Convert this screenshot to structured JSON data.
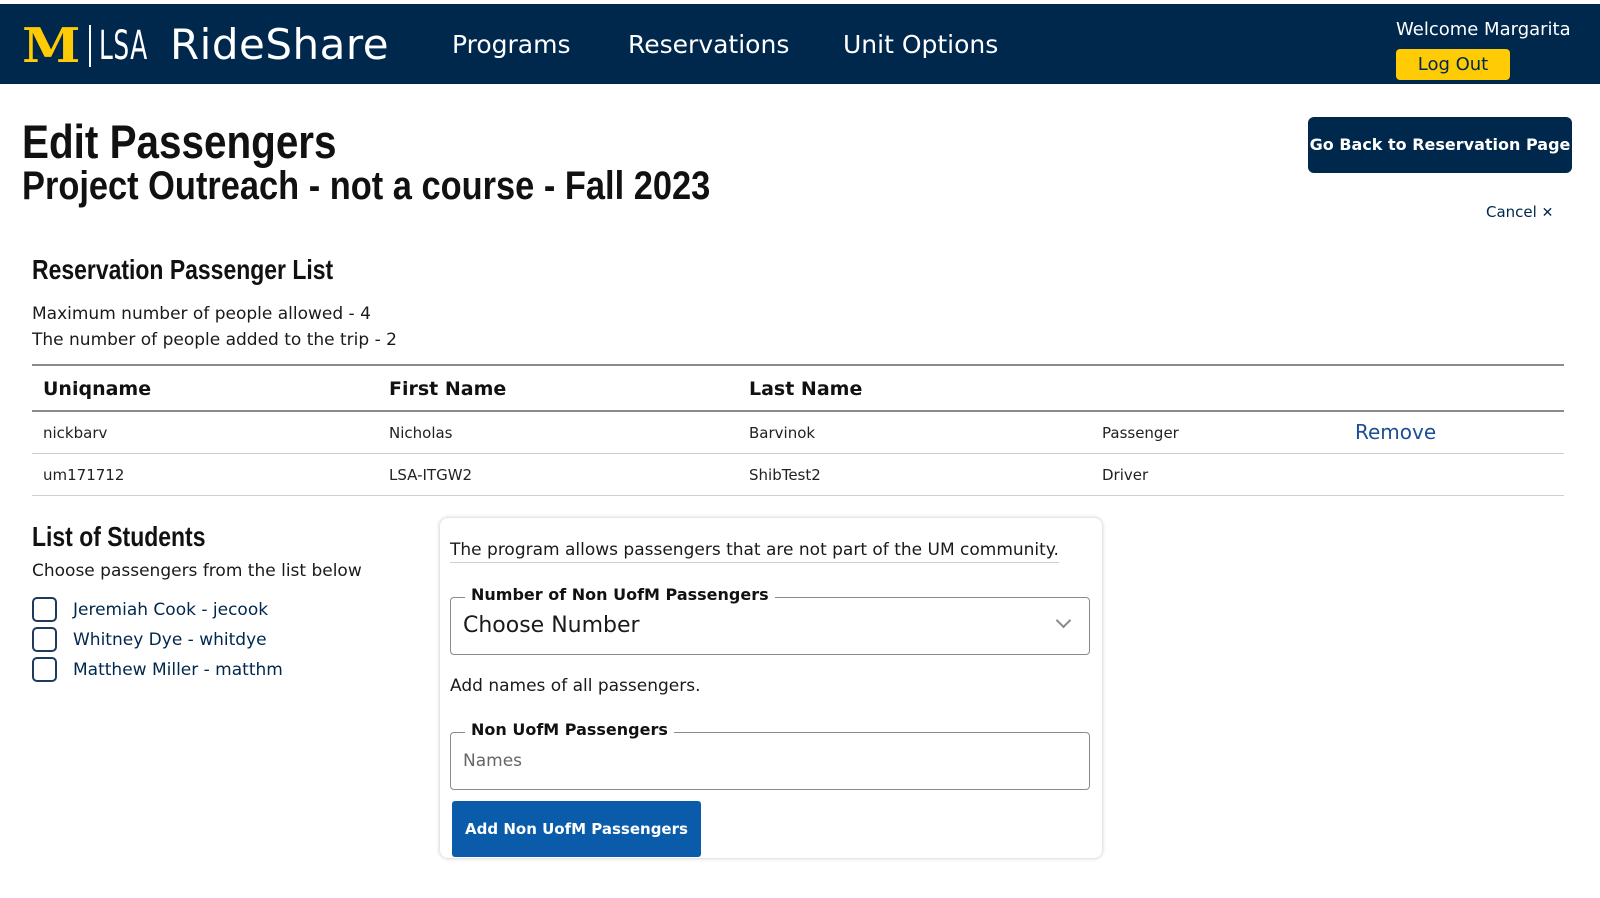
{
  "header": {
    "logo_mark": "M",
    "logo_unit": "LSA",
    "app_name": "RideShare",
    "nav": [
      "Programs",
      "Reservations",
      "Unit Options"
    ],
    "welcome": "Welcome Margarita",
    "logout_label": "Log Out"
  },
  "page": {
    "title": "Edit Passengers",
    "subtitle": "Project Outreach - not a course - Fall 2023",
    "back_button": "Go Back to Reservation Page",
    "cancel_label": "Cancel",
    "cancel_icon": "✕"
  },
  "passenger_list": {
    "heading": "Reservation Passenger List",
    "max_people": "Maximum number of people allowed - 4",
    "added_people": "The number of people added to the trip - 2",
    "columns": [
      "Uniqname",
      "First Name",
      "Last Name"
    ],
    "rows": [
      {
        "uniqname": "nickbarv",
        "first": "Nicholas",
        "last": "Barvinok",
        "role": "Passenger",
        "action": "Remove"
      },
      {
        "uniqname": "um171712",
        "first": "LSA-ITGW2",
        "last": "ShibTest2",
        "role": "Driver",
        "action": ""
      }
    ]
  },
  "students": {
    "heading": "List of Students",
    "instruction": "Choose passengers from the list below",
    "items": [
      "Jeremiah Cook - jecook",
      "Whitney Dye - whitdye",
      "Matthew Miller - matthm"
    ]
  },
  "non_um": {
    "note": "The program allows passengers that are not part of the UM community.",
    "number_label": "Number of Non UofM Passengers",
    "number_value": "Choose Number",
    "add_names_text": "Add names of all passengers.",
    "names_label": "Non UofM Passengers",
    "names_placeholder": "Names",
    "add_button": "Add Non UofM Passengers"
  },
  "colors": {
    "navy": "#00274c",
    "maize": "#ffcb05",
    "link_blue": "#1c4e96",
    "button_blue": "#0a5cab"
  }
}
